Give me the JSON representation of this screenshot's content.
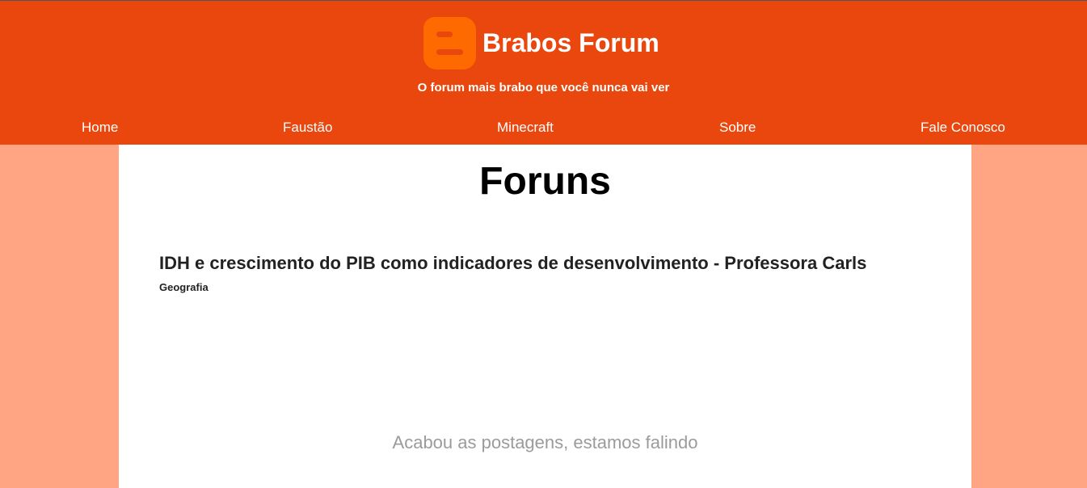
{
  "site": {
    "title": "Brabos Forum",
    "tagline": "O forum mais brabo que você nunca vai ver",
    "logo_icon": "blogger-logo-icon",
    "colors": {
      "header": "#e9470e",
      "logo": "#ff6a00",
      "side_background": "#ffa584"
    }
  },
  "nav": {
    "items": [
      {
        "label": "Home"
      },
      {
        "label": "Faustão"
      },
      {
        "label": "Minecraft"
      },
      {
        "label": "Sobre"
      },
      {
        "label": "Fale Conosco"
      }
    ]
  },
  "main": {
    "title": "Foruns",
    "posts": [
      {
        "title": "IDH e crescimento do PIB como indicadores de desenvolvimento - Professora Carls",
        "category": "Geografia"
      }
    ],
    "empty_message": "Acabou as postagens, estamos falindo"
  }
}
